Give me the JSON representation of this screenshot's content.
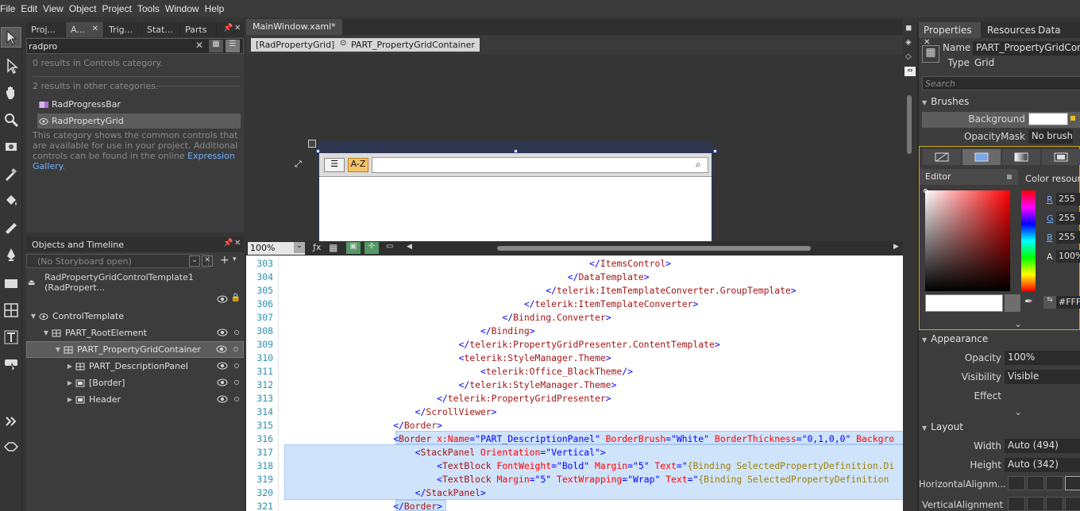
{
  "menu": [
    "File",
    "Edit",
    "View",
    "Object",
    "Project",
    "Tools",
    "Window",
    "Help"
  ],
  "assets": {
    "tabs": [
      "Proj...",
      "A...",
      "Trig...",
      "Stat...",
      "Parts"
    ],
    "search_value": "radpro",
    "no_results": "0 results in Controls category.",
    "other_results": "2 results in other categories.",
    "items": [
      "RadProgressBar",
      "RadPropertyGrid"
    ],
    "description": "This category shows the common controls that are available for use in your project. Additional controls can be found in the online",
    "link_text": "Expression Gallery",
    "link_tail": "."
  },
  "objects": {
    "title": "Objects and Timeline",
    "storyboard": "(No Storyboard open)",
    "scope": "RadPropertyGridControlTemplate1 (RadPropert...",
    "tree": [
      "ControlTemplate",
      "PART_RootElement",
      "PART_PropertyGridContainer",
      "PART_DescriptionPanel",
      "[Border]",
      "Header"
    ]
  },
  "document": {
    "tab": "MainWindow.xaml*",
    "breadcrumb": [
      "[RadPropertyGrid]",
      "PART_PropertyGridContainer"
    ],
    "sort_button": "A-Z",
    "zoom": "100%"
  },
  "code": {
    "lines": [
      {
        "n": "303",
        "i": 56,
        "parts": [
          [
            "p",
            "</"
          ],
          [
            "t",
            "ItemsControl"
          ],
          [
            "p",
            ">"
          ]
        ]
      },
      {
        "n": "304",
        "i": 52,
        "parts": [
          [
            "p",
            "</"
          ],
          [
            "t",
            "DataTemplate"
          ],
          [
            "p",
            ">"
          ]
        ]
      },
      {
        "n": "305",
        "i": 48,
        "parts": [
          [
            "p",
            "</"
          ],
          [
            "t",
            "telerik:ItemTemplateConverter.GroupTemplate"
          ],
          [
            "p",
            ">"
          ]
        ]
      },
      {
        "n": "306",
        "i": 44,
        "parts": [
          [
            "p",
            "</"
          ],
          [
            "t",
            "telerik:ItemTemplateConverter"
          ],
          [
            "p",
            ">"
          ]
        ]
      },
      {
        "n": "307",
        "i": 40,
        "parts": [
          [
            "p",
            "</"
          ],
          [
            "t",
            "Binding.Converter"
          ],
          [
            "p",
            ">"
          ]
        ]
      },
      {
        "n": "308",
        "i": 36,
        "parts": [
          [
            "p",
            "</"
          ],
          [
            "t",
            "Binding"
          ],
          [
            "p",
            ">"
          ]
        ]
      },
      {
        "n": "309",
        "i": 32,
        "parts": [
          [
            "p",
            "</"
          ],
          [
            "t",
            "telerik:PropertyGridPresenter.ContentTemplate"
          ],
          [
            "p",
            ">"
          ]
        ]
      },
      {
        "n": "310",
        "i": 32,
        "parts": [
          [
            "p",
            "<"
          ],
          [
            "t",
            "telerik:StyleManager.Theme"
          ],
          [
            "p",
            ">"
          ]
        ]
      },
      {
        "n": "311",
        "i": 36,
        "parts": [
          [
            "p",
            "<"
          ],
          [
            "t",
            "telerik:Office_BlackTheme"
          ],
          [
            "p",
            "/>"
          ]
        ]
      },
      {
        "n": "312",
        "i": 32,
        "parts": [
          [
            "p",
            "</"
          ],
          [
            "t",
            "telerik:StyleManager.Theme"
          ],
          [
            "p",
            ">"
          ]
        ]
      },
      {
        "n": "313",
        "i": 28,
        "parts": [
          [
            "p",
            "</"
          ],
          [
            "t",
            "telerik:PropertyGridPresenter"
          ],
          [
            "p",
            ">"
          ]
        ]
      },
      {
        "n": "314",
        "i": 24,
        "parts": [
          [
            "p",
            "</"
          ],
          [
            "t",
            "ScrollViewer"
          ],
          [
            "p",
            ">"
          ]
        ]
      },
      {
        "n": "315",
        "i": 20,
        "parts": [
          [
            "p",
            "</"
          ],
          [
            "t",
            "Border"
          ],
          [
            "p",
            ">"
          ]
        ]
      },
      {
        "n": "316",
        "i": 20,
        "hl": true,
        "parts": [
          [
            "p",
            "<"
          ],
          [
            "t",
            "Border"
          ],
          [
            "a",
            " x:Name"
          ],
          [
            "p",
            "=\""
          ],
          [
            "v",
            "PART_DescriptionPanel"
          ],
          [
            "p",
            "\""
          ],
          [
            "a",
            " BorderBrush"
          ],
          [
            "p",
            "=\""
          ],
          [
            "v",
            "White"
          ],
          [
            "p",
            "\""
          ],
          [
            "a",
            " BorderThickness"
          ],
          [
            "p",
            "=\""
          ],
          [
            "v",
            "0,1,0,0"
          ],
          [
            "p",
            "\""
          ],
          [
            "a",
            " Backgro"
          ]
        ]
      },
      {
        "n": "317",
        "i": 24,
        "hl": true,
        "parts": [
          [
            "p",
            "<"
          ],
          [
            "t",
            "StackPanel"
          ],
          [
            "a",
            " Orientation"
          ],
          [
            "p",
            "=\""
          ],
          [
            "v",
            "Vertical"
          ],
          [
            "p",
            "\">"
          ]
        ]
      },
      {
        "n": "318",
        "i": 28,
        "hl": true,
        "parts": [
          [
            "p",
            "<"
          ],
          [
            "t",
            "TextBlock"
          ],
          [
            "a",
            " FontWeight"
          ],
          [
            "p",
            "=\""
          ],
          [
            "v",
            "Bold"
          ],
          [
            "p",
            "\""
          ],
          [
            "a",
            " Margin"
          ],
          [
            "p",
            "=\""
          ],
          [
            "v",
            "5"
          ],
          [
            "p",
            "\""
          ],
          [
            "a",
            " Text"
          ],
          [
            "p",
            "=\""
          ],
          [
            "b",
            "{Binding SelectedPropertyDefinition.Di"
          ]
        ]
      },
      {
        "n": "319",
        "i": 28,
        "hl": true,
        "parts": [
          [
            "p",
            "<"
          ],
          [
            "t",
            "TextBlock"
          ],
          [
            "a",
            " Margin"
          ],
          [
            "p",
            "=\""
          ],
          [
            "v",
            "5"
          ],
          [
            "p",
            "\""
          ],
          [
            "a",
            " TextWrapping"
          ],
          [
            "p",
            "=\""
          ],
          [
            "v",
            "Wrap"
          ],
          [
            "p",
            "\""
          ],
          [
            "a",
            " Text"
          ],
          [
            "p",
            "=\""
          ],
          [
            "b",
            "{Binding SelectedPropertyDefinition"
          ]
        ]
      },
      {
        "n": "320",
        "i": 24,
        "hl": true,
        "parts": [
          [
            "p",
            "</"
          ],
          [
            "t",
            "StackPanel"
          ],
          [
            "p",
            ">"
          ]
        ]
      },
      {
        "n": "321",
        "i": 20,
        "hl": true,
        "parts": [
          [
            "p",
            "</"
          ],
          [
            "t",
            "Border"
          ],
          [
            "p",
            ">"
          ]
        ]
      }
    ]
  },
  "properties": {
    "tabs": [
      "Properties",
      "Resources",
      "Data"
    ],
    "name_label": "Name",
    "name_value": "PART_PropertyGridConta",
    "type_label": "Type",
    "type_value": "Grid",
    "search_placeholder": "Search",
    "brushes_title": "Brushes",
    "background_label": "Background",
    "opacitymask_label": "OpacityMask",
    "opacitymask_value": "No brush",
    "editor_label": "Editor",
    "color_resources": "Color resourc",
    "r_label": "R",
    "r_value": "255",
    "g_label": "G",
    "g_value": "255",
    "b_label": "B",
    "b_value": "255",
    "a_label": "A",
    "a_value": "100%",
    "hex_value": "#FFFF",
    "appearance_title": "Appearance",
    "opacity_label": "Opacity",
    "opacity_value": "100%",
    "visibility_label": "Visibility",
    "visibility_value": "Visible",
    "effect_label": "Effect",
    "layout_title": "Layout",
    "width_label": "Width",
    "width_value": "Auto (494)",
    "height_label": "Height",
    "height_value": "Auto (342)",
    "halign_label": "HorizontalAlignm...",
    "valign_label": "VerticalAlignment"
  }
}
